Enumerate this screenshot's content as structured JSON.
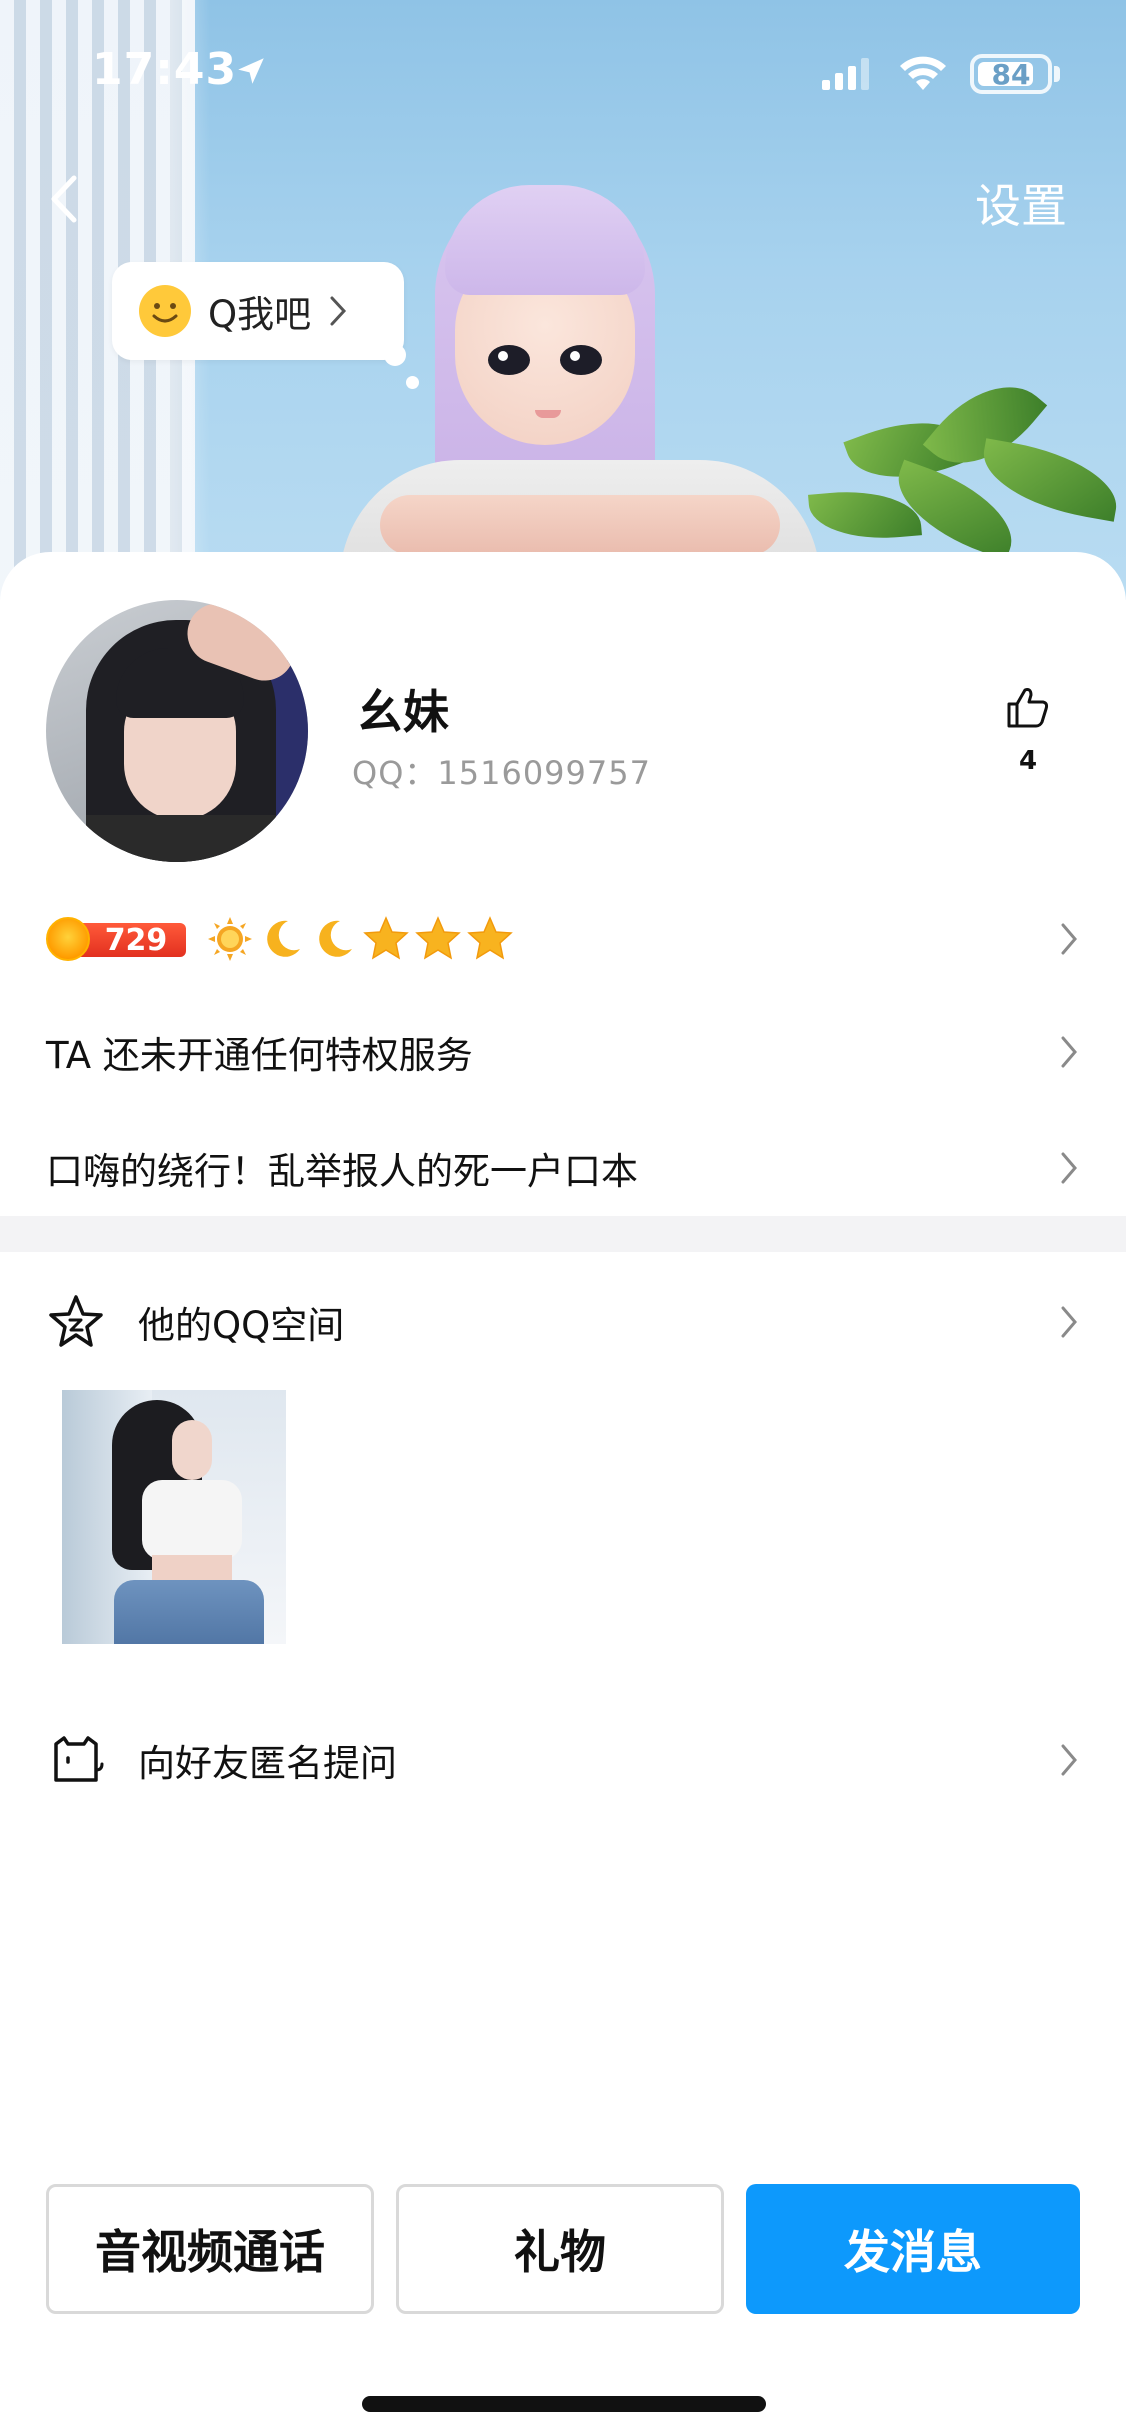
{
  "status_bar": {
    "time": "17:43",
    "battery": "84",
    "battery_fraction": 0.84
  },
  "nav": {
    "settings_label": "设置"
  },
  "bubble": {
    "label": "Q我吧"
  },
  "profile": {
    "name": "幺妹",
    "qq_id": "QQ：1516099757",
    "likes": "4"
  },
  "level": {
    "vip_value": "729",
    "icons": [
      "sun-icon",
      "moon-icon",
      "moon-icon",
      "star-icon",
      "star-icon",
      "star-icon"
    ]
  },
  "rows": {
    "privilege": "TA 还未开通任何特权服务",
    "signature": "口嗨的绕行！乱举报人的死一户口本",
    "qzone": "他的QQ空间",
    "anonymous_question": "向好友匿名提问"
  },
  "actions": {
    "call": "音视频通话",
    "gift": "礼物",
    "message": "发消息"
  },
  "colors": {
    "primary": "#0d99fc",
    "vip_red": "#e2301f",
    "secondary_text": "#9a9a9a"
  }
}
